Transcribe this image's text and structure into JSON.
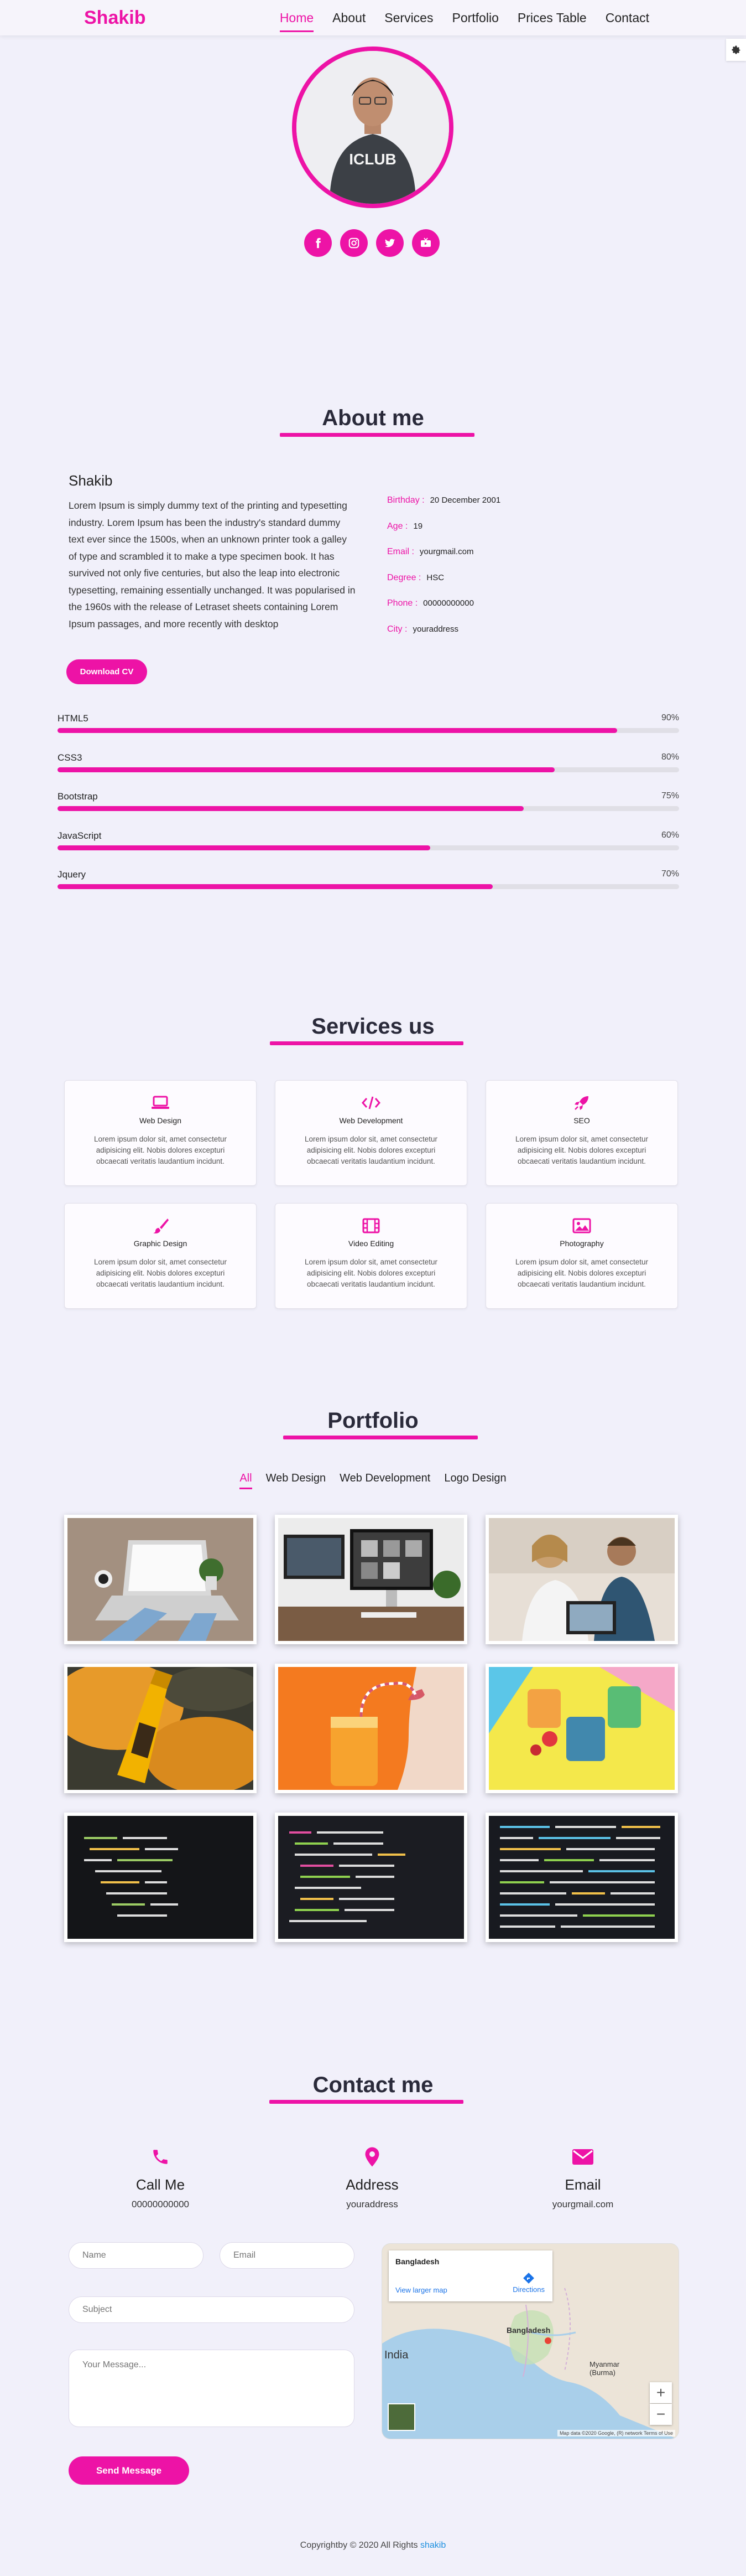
{
  "brand": "Shakib",
  "nav": [
    {
      "label": "Home",
      "active": true
    },
    {
      "label": "About",
      "active": false
    },
    {
      "label": "Services",
      "active": false
    },
    {
      "label": "Portfolio",
      "active": false
    },
    {
      "label": "Prices Table",
      "active": false
    },
    {
      "label": "Contact",
      "active": false
    }
  ],
  "hero": {
    "shirt_text": "ICLUB",
    "socials": [
      "facebook-icon",
      "instagram-icon",
      "twitter-icon",
      "youtube-icon"
    ]
  },
  "about": {
    "title": "About me",
    "name": "Shakib",
    "text": "Lorem Ipsum is simply dummy text of the printing and typesetting industry. Lorem Ipsum has been the industry's standard dummy text ever since the 1500s, when an unknown printer took a galley of type and scrambled it to make a type specimen book. It has survived not only five centuries, but also the leap into electronic typesetting, remaining essentially unchanged. It was popularised in the 1960s with the release of Letraset sheets containing Lorem Ipsum passages, and more recently with desktop",
    "info": [
      {
        "key": "Birthday :",
        "value": "20 December 2001"
      },
      {
        "key": "Age :",
        "value": "19"
      },
      {
        "key": "Email :",
        "value": "yourgmail.com"
      },
      {
        "key": "Degree :",
        "value": "HSC"
      },
      {
        "key": "Phone :",
        "value": "00000000000"
      },
      {
        "key": "City :",
        "value": "youraddress"
      }
    ],
    "download_label": "Download CV",
    "skills": [
      {
        "name": "HTML5",
        "percent": "90%",
        "level": 0.9
      },
      {
        "name": "CSS3",
        "percent": "80%",
        "level": 0.8
      },
      {
        "name": "Bootstrap",
        "percent": "75%",
        "level": 0.75
      },
      {
        "name": "JavaScript",
        "percent": "60%",
        "level": 0.6
      },
      {
        "name": "Jquery",
        "percent": "70%",
        "level": 0.7
      }
    ]
  },
  "services": {
    "title": "Services us",
    "items": [
      {
        "title": "Web Design",
        "icon": "laptop-icon",
        "desc": "Lorem ipsum dolor sit, amet consectetur adipisicing elit. Nobis dolores excepturi obcaecati veritatis laudantium incidunt."
      },
      {
        "title": "Web Development",
        "icon": "code-icon",
        "desc": "Lorem ipsum dolor sit, amet consectetur adipisicing elit. Nobis dolores excepturi obcaecati veritatis laudantium incidunt."
      },
      {
        "title": "SEO",
        "icon": "rocket-icon",
        "desc": "Lorem ipsum dolor sit, amet consectetur adipisicing elit. Nobis dolores excepturi obcaecati veritatis laudantium incidunt."
      },
      {
        "title": "Graphic Design",
        "icon": "paint-brush-icon",
        "desc": "Lorem ipsum dolor sit, amet consectetur adipisicing elit. Nobis dolores excepturi obcaecati veritatis laudantium incidunt."
      },
      {
        "title": "Video Editing",
        "icon": "film-icon",
        "desc": "Lorem ipsum dolor sit, amet consectetur adipisicing elit. Nobis dolores excepturi obcaecati veritatis laudantium incidunt."
      },
      {
        "title": "Photography",
        "icon": "image-icon",
        "desc": "Lorem ipsum dolor sit, amet consectetur adipisicing elit. Nobis dolores excepturi obcaecati veritatis laudantium incidunt."
      }
    ]
  },
  "portfolio": {
    "title": "Portfolio",
    "filters": [
      {
        "label": "All",
        "active": true
      },
      {
        "label": "Web Design",
        "active": false
      },
      {
        "label": "Web Development",
        "active": false
      },
      {
        "label": "Logo Design",
        "active": false
      }
    ],
    "items": [
      "laptop-desk-photo",
      "imac-workspace-photo",
      "coworkers-photo",
      "bottle-photo",
      "juice-photo",
      "drinks-photo",
      "code-photo",
      "code-photo",
      "code-photo"
    ]
  },
  "contact": {
    "title": "Contact me",
    "columns": [
      {
        "title": "Call Me",
        "value": "00000000000",
        "icon": "phone-icon"
      },
      {
        "title": "Address",
        "value": "youraddress",
        "icon": "map-marker-icon"
      },
      {
        "title": "Email",
        "value": "yourgmail.com",
        "icon": "envelope-icon"
      }
    ],
    "form": {
      "name_placeholder": "Name",
      "email_placeholder": "Email",
      "subject_placeholder": "Subject",
      "message_placeholder": "Your Message...",
      "send_label": "Send Message"
    },
    "map": {
      "country": "Bangladesh",
      "view_larger": "View larger map",
      "directions": "Directions",
      "labels": [
        "India",
        "Bangladesh",
        "Myanmar (Burma)"
      ],
      "footer": "Map data ©2020 Google, (R) network   Terms of Use"
    }
  },
  "footer": {
    "prefix": "Copyrightby © 2020 All Rights",
    "author": "shakib"
  },
  "colors": {
    "accent": "#ed13a6",
    "background": "#f1f0fa"
  }
}
